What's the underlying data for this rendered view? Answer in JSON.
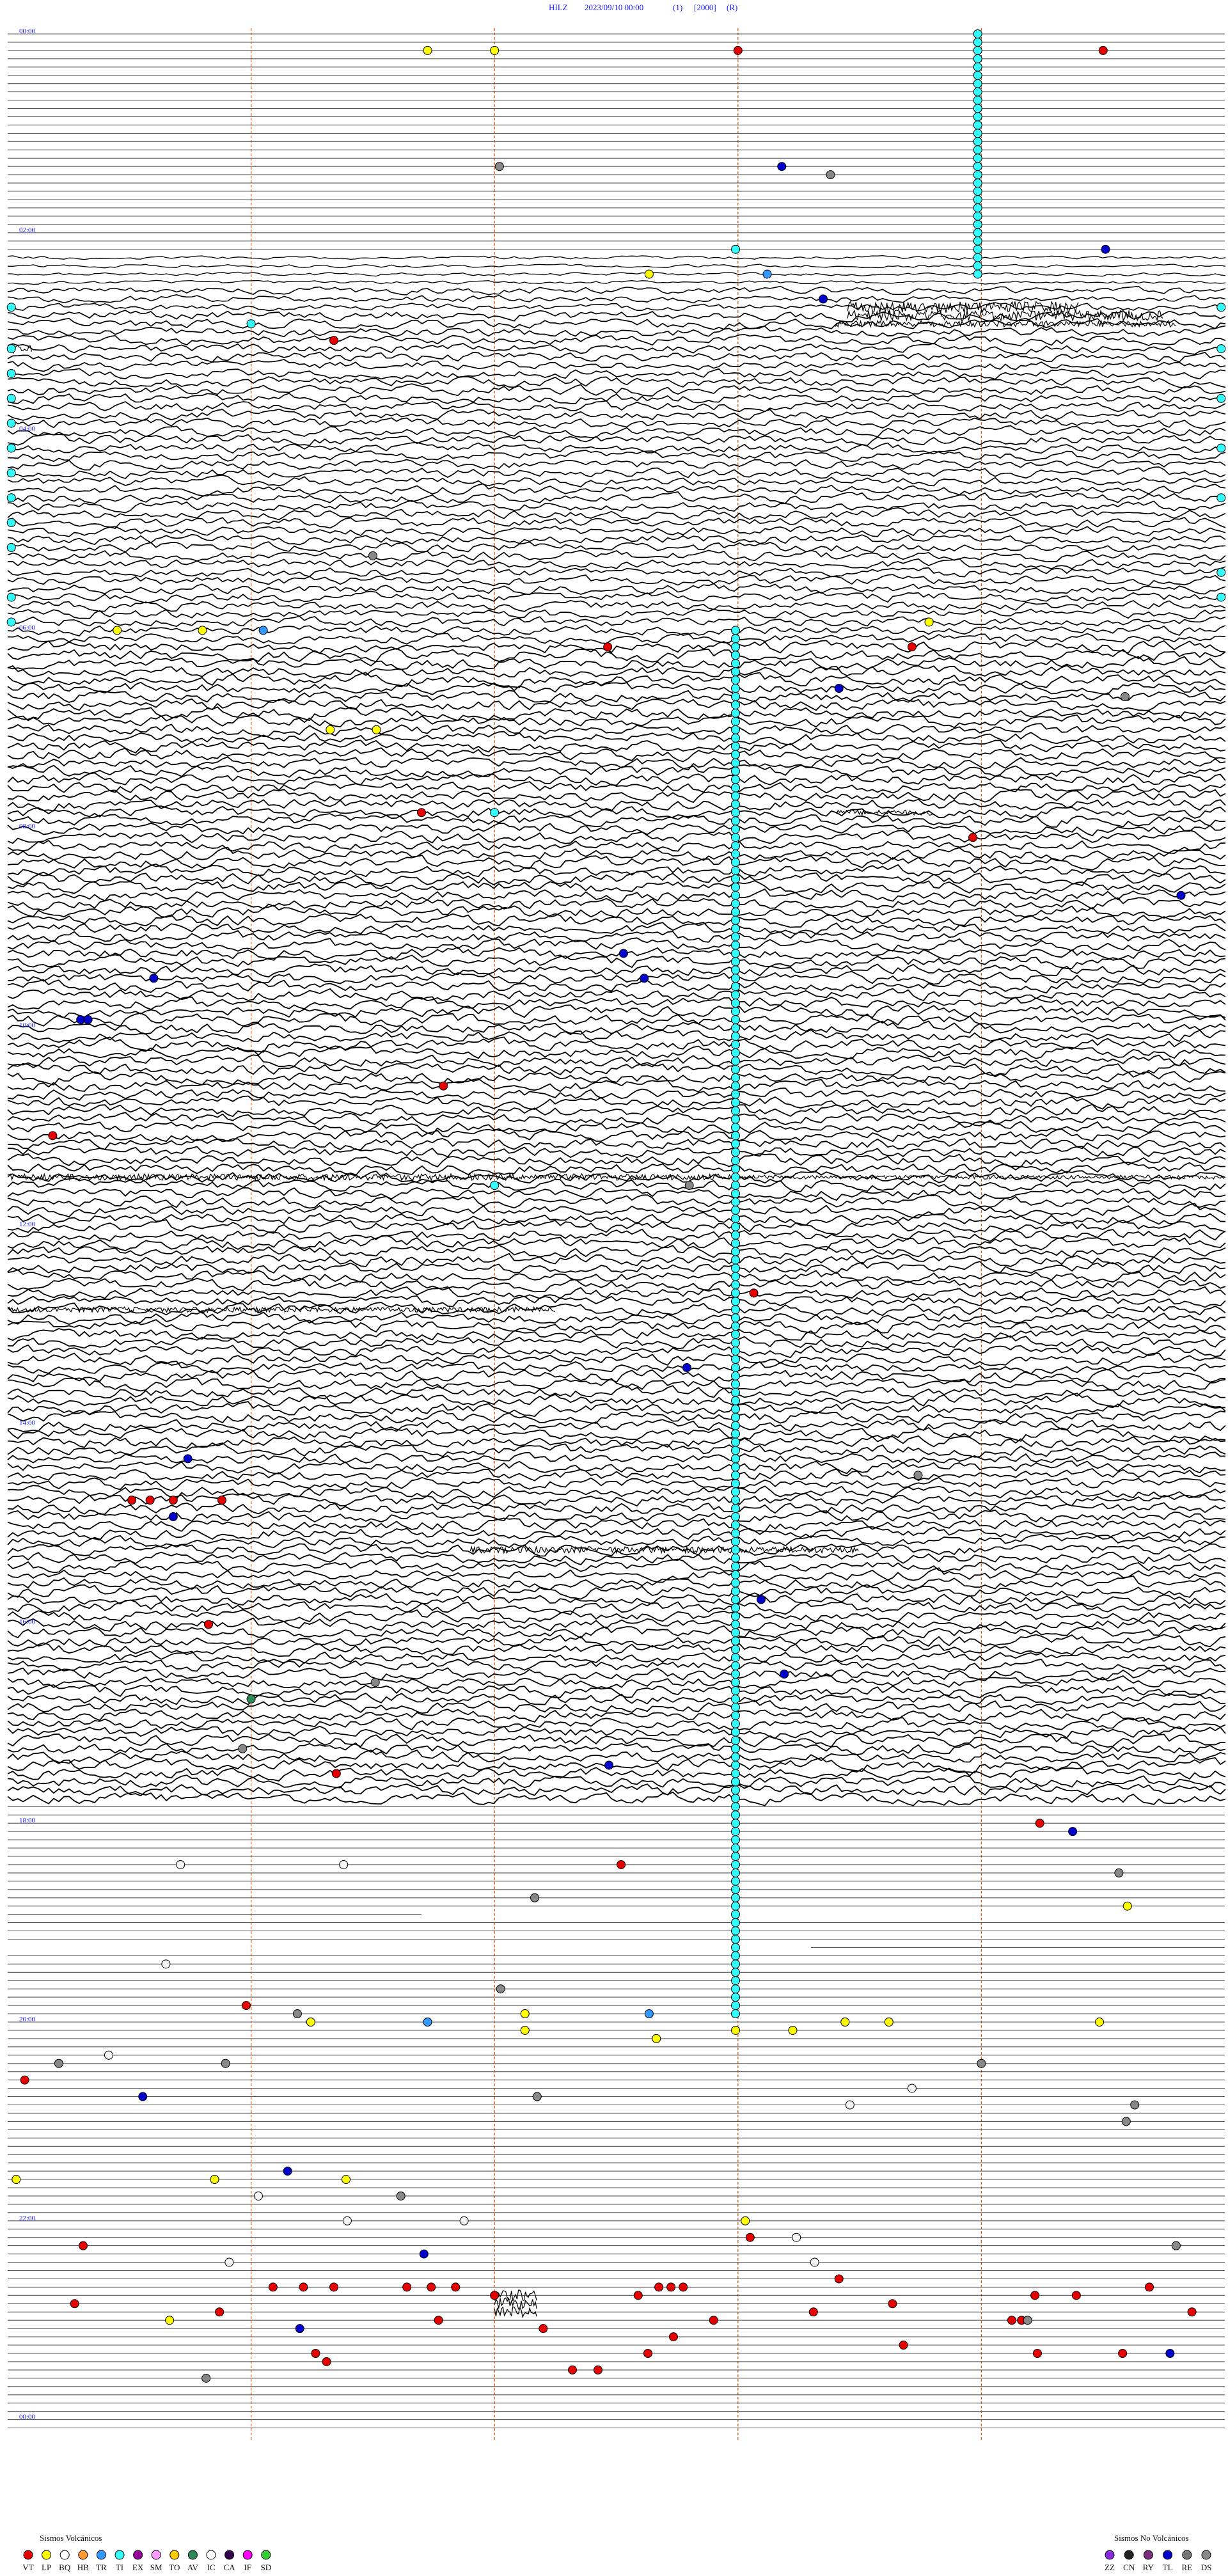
{
  "chart_data": {
    "type": "helicorder",
    "title": {
      "station": "HILZ",
      "datetime": "2023/09/10 00:00",
      "flag": "(1)",
      "scale": "[2000]",
      "mode": "(R)"
    },
    "hour_labels": [
      {
        "row": 0,
        "text": "00:00"
      },
      {
        "row": 24,
        "text": "02:00"
      },
      {
        "row": 48,
        "text": "04:00"
      },
      {
        "row": 72,
        "text": "06:00"
      },
      {
        "row": 96,
        "text": "08:00"
      },
      {
        "row": 120,
        "text": "10:00"
      },
      {
        "row": 144,
        "text": "12:00"
      },
      {
        "row": 168,
        "text": "14:00"
      },
      {
        "row": 192,
        "text": "16:00"
      },
      {
        "row": 216,
        "text": "18:00"
      },
      {
        "row": 240,
        "text": "20:00"
      },
      {
        "row": 264,
        "text": "22:00"
      },
      {
        "row": 288,
        "text": "00:00"
      }
    ],
    "rows_total": 290,
    "minutes_per_row": 5,
    "row_active": [
      {
        "from": 0,
        "to": 27,
        "level": 0
      },
      {
        "from": 27,
        "to": 31,
        "level": 0.6
      },
      {
        "from": 31,
        "to": 34,
        "level": 1.3
      },
      {
        "from": 34,
        "to": 74,
        "level": 1.7
      },
      {
        "from": 74,
        "to": 214,
        "level": 2.0
      },
      {
        "from": 214,
        "to": 290,
        "level": 0
      }
    ],
    "ticks": [
      0.2,
      0.4,
      0.6,
      0.8
    ],
    "burst_segments": [
      {
        "row": 33,
        "x0": 0.69,
        "x1": 0.88,
        "amp": 9
      },
      {
        "row": 34,
        "x0": 0.69,
        "x1": 0.95,
        "amp": 8
      },
      {
        "row": 35,
        "x0": 0.68,
        "x1": 0.96,
        "amp": 5
      },
      {
        "row": 38,
        "x0": 0.0,
        "x1": 0.02,
        "amp": 8
      },
      {
        "row": 94,
        "x0": 0.68,
        "x1": 0.76,
        "amp": 4
      },
      {
        "row": 138,
        "x0": 0.0,
        "x1": 0.6,
        "amp": 5
      },
      {
        "row": 138,
        "x0": 0.6,
        "x1": 1.0,
        "amp": 3
      },
      {
        "row": 154,
        "x0": 0.0,
        "x1": 0.45,
        "amp": 4
      },
      {
        "row": 183,
        "x0": 0.38,
        "x1": 0.7,
        "amp": 5
      },
      {
        "row": 273,
        "x0": 0.4,
        "x1": 0.435,
        "amp": 9
      },
      {
        "row": 274,
        "x0": 0.4,
        "x1": 0.435,
        "amp": 9
      },
      {
        "row": 275,
        "x0": 0.4,
        "x1": 0.435,
        "amp": 9
      }
    ],
    "flat_partials": [
      {
        "row": 227,
        "x0": 0.0,
        "x1": 0.34
      },
      {
        "row": 231,
        "x0": 0.66,
        "x1": 1.0
      },
      {
        "row": 292,
        "x0": 0.0,
        "x1": 0.22
      }
    ],
    "ti_columns": [
      {
        "x": 0.797,
        "from": 0,
        "to": 29
      },
      {
        "x": 0.598,
        "from": 72,
        "to": 239
      }
    ],
    "events": [
      {
        "code": "LP",
        "row": 2,
        "x": 0.345
      },
      {
        "code": "LP",
        "row": 2,
        "x": 0.4
      },
      {
        "code": "VT",
        "row": 2,
        "x": 0.6
      },
      {
        "code": "VT",
        "row": 2,
        "x": 0.9
      },
      {
        "code": "DS",
        "row": 16,
        "x": 0.404
      },
      {
        "code": "TL",
        "row": 16,
        "x": 0.636
      },
      {
        "code": "DS",
        "row": 17,
        "x": 0.676
      },
      {
        "code": "TI",
        "row": 26,
        "x": 0.598
      },
      {
        "code": "TL",
        "row": 26,
        "x": 0.902
      },
      {
        "code": "LP",
        "row": 29,
        "x": 0.527
      },
      {
        "code": "TR",
        "row": 29,
        "x": 0.624
      },
      {
        "code": "TL",
        "row": 32,
        "x": 0.67
      },
      {
        "code": "TI",
        "row": 33,
        "x": 0.003
      },
      {
        "code": "TI",
        "row": 33,
        "x": 0.997
      },
      {
        "code": "TI",
        "row": 35,
        "x": 0.2
      },
      {
        "code": "VT",
        "row": 37,
        "x": 0.268
      },
      {
        "code": "TI",
        "row": 38,
        "x": 0.003
      },
      {
        "code": "TI",
        "row": 38,
        "x": 0.997
      },
      {
        "code": "TI",
        "row": 41,
        "x": 0.003
      },
      {
        "code": "TI",
        "row": 44,
        "x": 0.003
      },
      {
        "code": "TI",
        "row": 44,
        "x": 0.997
      },
      {
        "code": "TI",
        "row": 47,
        "x": 0.003
      },
      {
        "code": "TI",
        "row": 50,
        "x": 0.003
      },
      {
        "code": "TI",
        "row": 50,
        "x": 0.997
      },
      {
        "code": "TI",
        "row": 53,
        "x": 0.003
      },
      {
        "code": "TI",
        "row": 56,
        "x": 0.003
      },
      {
        "code": "TI",
        "row": 56,
        "x": 0.997
      },
      {
        "code": "TI",
        "row": 59,
        "x": 0.003
      },
      {
        "code": "TI",
        "row": 62,
        "x": 0.003
      },
      {
        "code": "DS",
        "row": 63,
        "x": 0.3
      },
      {
        "code": "TI",
        "row": 65,
        "x": 0.997
      },
      {
        "code": "TI",
        "row": 68,
        "x": 0.003
      },
      {
        "code": "TI",
        "row": 68,
        "x": 0.997
      },
      {
        "code": "TI",
        "row": 71,
        "x": 0.003
      },
      {
        "code": "LP",
        "row": 72,
        "x": 0.09
      },
      {
        "code": "LP",
        "row": 72,
        "x": 0.16
      },
      {
        "code": "TR",
        "row": 72,
        "x": 0.21
      },
      {
        "code": "LP",
        "row": 71,
        "x": 0.757
      },
      {
        "code": "VT",
        "row": 74,
        "x": 0.493
      },
      {
        "code": "VT",
        "row": 74,
        "x": 0.743
      },
      {
        "code": "TL",
        "row": 79,
        "x": 0.683
      },
      {
        "code": "DS",
        "row": 80,
        "x": 0.918
      },
      {
        "code": "LP",
        "row": 84,
        "x": 0.265
      },
      {
        "code": "LP",
        "row": 84,
        "x": 0.303
      },
      {
        "code": "VT",
        "row": 94,
        "x": 0.34
      },
      {
        "code": "TI",
        "row": 94,
        "x": 0.4
      },
      {
        "code": "VT",
        "row": 97,
        "x": 0.793
      },
      {
        "code": "TL",
        "row": 104,
        "x": 0.964
      },
      {
        "code": "TL",
        "row": 111,
        "x": 0.506
      },
      {
        "code": "TL",
        "row": 114,
        "x": 0.12
      },
      {
        "code": "TL",
        "row": 114,
        "x": 0.523
      },
      {
        "code": "TL",
        "row": 119,
        "x": 0.06
      },
      {
        "code": "TL",
        "row": 119,
        "x": 0.066
      },
      {
        "code": "VT",
        "row": 127,
        "x": 0.358
      },
      {
        "code": "VT",
        "row": 133,
        "x": 0.037
      },
      {
        "code": "TI",
        "row": 139,
        "x": 0.4
      },
      {
        "code": "DS",
        "row": 139,
        "x": 0.56
      },
      {
        "code": "VT",
        "row": 152,
        "x": 0.613
      },
      {
        "code": "TL",
        "row": 161,
        "x": 0.558
      },
      {
        "code": "TL",
        "row": 172,
        "x": 0.148
      },
      {
        "code": "DS",
        "row": 174,
        "x": 0.748
      },
      {
        "code": "VT",
        "row": 177,
        "x": 0.102
      },
      {
        "code": "VT",
        "row": 177,
        "x": 0.117
      },
      {
        "code": "VT",
        "row": 177,
        "x": 0.136
      },
      {
        "code": "VT",
        "row": 177,
        "x": 0.176
      },
      {
        "code": "TL",
        "row": 179,
        "x": 0.136
      },
      {
        "code": "TL",
        "row": 189,
        "x": 0.619
      },
      {
        "code": "VT",
        "row": 192,
        "x": 0.165
      },
      {
        "code": "TL",
        "row": 198,
        "x": 0.638
      },
      {
        "code": "DS",
        "row": 199,
        "x": 0.302
      },
      {
        "code": "AV",
        "row": 201,
        "x": 0.2
      },
      {
        "code": "DS",
        "row": 207,
        "x": 0.193
      },
      {
        "code": "TL",
        "row": 209,
        "x": 0.494
      },
      {
        "code": "VT",
        "row": 210,
        "x": 0.27
      },
      {
        "code": "VT",
        "row": 216,
        "x": 0.848
      },
      {
        "code": "TL",
        "row": 217,
        "x": 0.875
      },
      {
        "code": "IC",
        "row": 221,
        "x": 0.142
      },
      {
        "code": "IC",
        "row": 221,
        "x": 0.276
      },
      {
        "code": "VT",
        "row": 221,
        "x": 0.504
      },
      {
        "code": "DS",
        "row": 222,
        "x": 0.913
      },
      {
        "code": "DS",
        "row": 225,
        "x": 0.433
      },
      {
        "code": "LP",
        "row": 226,
        "x": 0.92
      },
      {
        "code": "IC",
        "row": 233,
        "x": 0.13
      },
      {
        "code": "DS",
        "row": 236,
        "x": 0.405
      },
      {
        "code": "VT",
        "row": 238,
        "x": 0.196
      },
      {
        "code": "DS",
        "row": 239,
        "x": 0.238
      },
      {
        "code": "LP",
        "row": 239,
        "x": 0.425
      },
      {
        "code": "TR",
        "row": 239,
        "x": 0.527
      },
      {
        "code": "TR",
        "row": 240,
        "x": 0.345
      },
      {
        "code": "LP",
        "row": 240,
        "x": 0.249
      },
      {
        "code": "LP",
        "row": 240,
        "x": 0.688
      },
      {
        "code": "LP",
        "row": 240,
        "x": 0.724
      },
      {
        "code": "LP",
        "row": 240,
        "x": 0.897
      },
      {
        "code": "LP",
        "row": 241,
        "x": 0.425
      },
      {
        "code": "LP",
        "row": 241,
        "x": 0.598
      },
      {
        "code": "LP",
        "row": 241,
        "x": 0.645
      },
      {
        "code": "LP",
        "row": 242,
        "x": 0.533
      },
      {
        "code": "IC",
        "row": 244,
        "x": 0.083
      },
      {
        "code": "DS",
        "row": 245,
        "x": 0.042
      },
      {
        "code": "DS",
        "row": 245,
        "x": 0.179
      },
      {
        "code": "DS",
        "row": 245,
        "x": 0.8
      },
      {
        "code": "VT",
        "row": 247,
        "x": 0.014
      },
      {
        "code": "IC",
        "row": 248,
        "x": 0.743
      },
      {
        "code": "TL",
        "row": 249,
        "x": 0.111
      },
      {
        "code": "DS",
        "row": 249,
        "x": 0.435
      },
      {
        "code": "IC",
        "row": 250,
        "x": 0.692
      },
      {
        "code": "DS",
        "row": 250,
        "x": 0.926
      },
      {
        "code": "DS",
        "row": 252,
        "x": 0.919
      },
      {
        "code": "LP",
        "row": 259,
        "x": 0.007
      },
      {
        "code": "TL",
        "row": 258,
        "x": 0.23
      },
      {
        "code": "LP",
        "row": 259,
        "x": 0.17
      },
      {
        "code": "LP",
        "row": 259,
        "x": 0.278
      },
      {
        "code": "IC",
        "row": 261,
        "x": 0.206
      },
      {
        "code": "DS",
        "row": 261,
        "x": 0.323
      },
      {
        "code": "IC",
        "row": 264,
        "x": 0.279
      },
      {
        "code": "IC",
        "row": 264,
        "x": 0.375
      },
      {
        "code": "LP",
        "row": 264,
        "x": 0.606
      },
      {
        "code": "VT",
        "row": 266,
        "x": 0.61
      },
      {
        "code": "IC",
        "row": 266,
        "x": 0.648
      },
      {
        "code": "VT",
        "row": 267,
        "x": 0.062
      },
      {
        "code": "TL",
        "row": 268,
        "x": 0.342
      },
      {
        "code": "DS",
        "row": 267,
        "x": 0.96
      },
      {
        "code": "IC",
        "row": 269,
        "x": 0.182
      },
      {
        "code": "IC",
        "row": 269,
        "x": 0.663
      },
      {
        "code": "VT",
        "row": 271,
        "x": 0.683
      },
      {
        "code": "VT",
        "row": 272,
        "x": 0.218
      },
      {
        "code": "VT",
        "row": 272,
        "x": 0.243
      },
      {
        "code": "VT",
        "row": 272,
        "x": 0.268
      },
      {
        "code": "VT",
        "row": 272,
        "x": 0.328
      },
      {
        "code": "VT",
        "row": 272,
        "x": 0.348
      },
      {
        "code": "VT",
        "row": 272,
        "x": 0.368
      },
      {
        "code": "VT",
        "row": 272,
        "x": 0.535
      },
      {
        "code": "VT",
        "row": 272,
        "x": 0.545
      },
      {
        "code": "VT",
        "row": 272,
        "x": 0.555
      },
      {
        "code": "VT",
        "row": 272,
        "x": 0.938
      },
      {
        "code": "VT",
        "row": 273,
        "x": 0.4
      },
      {
        "code": "VT",
        "row": 273,
        "x": 0.518
      },
      {
        "code": "VT",
        "row": 273,
        "x": 0.844
      },
      {
        "code": "VT",
        "row": 273,
        "x": 0.878
      },
      {
        "code": "VT",
        "row": 274,
        "x": 0.055
      },
      {
        "code": "VT",
        "row": 274,
        "x": 0.727
      },
      {
        "code": "VT",
        "row": 275,
        "x": 0.973
      },
      {
        "code": "VT",
        "row": 275,
        "x": 0.174
      },
      {
        "code": "VT",
        "row": 275,
        "x": 0.662
      },
      {
        "code": "LP",
        "row": 276,
        "x": 0.133
      },
      {
        "code": "VT",
        "row": 276,
        "x": 0.354
      },
      {
        "code": "VT",
        "row": 276,
        "x": 0.58
      },
      {
        "code": "VT",
        "row": 276,
        "x": 0.825
      },
      {
        "code": "VT",
        "row": 276,
        "x": 0.833
      },
      {
        "code": "DS",
        "row": 276,
        "x": 0.838
      },
      {
        "code": "TL",
        "row": 277,
        "x": 0.24
      },
      {
        "code": "VT",
        "row": 277,
        "x": 0.44
      },
      {
        "code": "VT",
        "row": 278,
        "x": 0.547
      },
      {
        "code": "VT",
        "row": 279,
        "x": 0.736
      },
      {
        "code": "VT",
        "row": 280,
        "x": 0.253
      },
      {
        "code": "VT",
        "row": 280,
        "x": 0.526
      },
      {
        "code": "VT",
        "row": 280,
        "x": 0.846
      },
      {
        "code": "VT",
        "row": 280,
        "x": 0.916
      },
      {
        "code": "TL",
        "row": 280,
        "x": 0.955
      },
      {
        "code": "VT",
        "row": 281,
        "x": 0.262
      },
      {
        "code": "VT",
        "row": 282,
        "x": 0.464
      },
      {
        "code": "VT",
        "row": 282,
        "x": 0.485
      },
      {
        "code": "DS",
        "row": 283,
        "x": 0.163
      }
    ],
    "legend_volcanic": {
      "title": "Sismos Volcánicos",
      "items": [
        {
          "code": "VT",
          "color": "#e60000"
        },
        {
          "code": "LP",
          "color": "#ffff00"
        },
        {
          "code": "BQ",
          "color": "#ffffff"
        },
        {
          "code": "HB",
          "color": "#ff9933"
        },
        {
          "code": "TR",
          "color": "#3399ff"
        },
        {
          "code": "TI",
          "color": "#33ffff"
        },
        {
          "code": "EX",
          "color": "#990099"
        },
        {
          "code": "SM",
          "color": "#ff99ff"
        },
        {
          "code": "TO",
          "color": "#ffcc00"
        },
        {
          "code": "AV",
          "color": "#2e8b57"
        },
        {
          "code": "IC",
          "color": "#ffffff"
        },
        {
          "code": "CA",
          "color": "#33004d"
        },
        {
          "code": "IF",
          "color": "#ff00ff"
        },
        {
          "code": "SD",
          "color": "#33cc33"
        }
      ]
    },
    "legend_nonvolcanic": {
      "title": "Sismos No Volcánicos",
      "items": [
        {
          "code": "ZZ",
          "color": "#8a2be2"
        },
        {
          "code": "CN",
          "color": "#222222"
        },
        {
          "code": "RY",
          "color": "#7b2c7b"
        },
        {
          "code": "TL",
          "color": "#0000cc"
        },
        {
          "code": "RE",
          "color": "#777777"
        },
        {
          "code": "DS",
          "color": "#888888"
        }
      ]
    },
    "colors": {
      "trace": "#000000",
      "flat_line": "#555555",
      "tick_line": "#e05a10",
      "label": "#1a1aff",
      "IC": "#f4f4f4",
      "BQ": "#ffffff"
    }
  }
}
